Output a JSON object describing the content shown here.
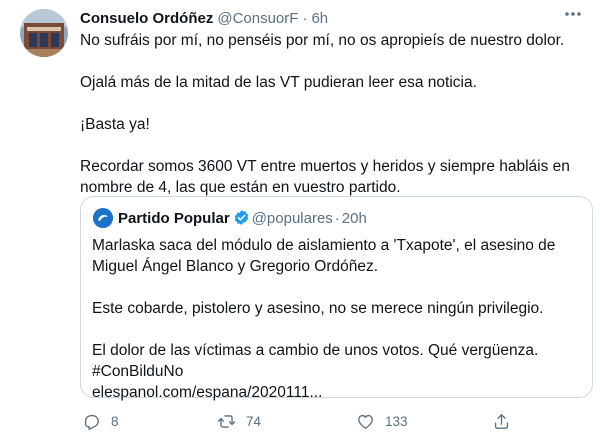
{
  "tweet": {
    "author_name": "Consuelo Ordóñez",
    "author_handle": "@ConsuorF",
    "separator": "·",
    "time": "6h",
    "lines": [
      "No sufráis por mí, no penséis por mí,  no os apropieís de nuestro dolor.",
      "",
      "Ojalá más de la mitad de las VT pudieran leer esa noticia.",
      "",
      "¡Basta ya!",
      "",
      "Recordar somos 3600 VT entre muertos y heridos y siempre habláis en",
      "nombre de 4, las que están en vuestro partido."
    ]
  },
  "quoted": {
    "author_name": "Partido Popular",
    "author_handle": "@populares",
    "separator": "·",
    "time": "20h",
    "lines": [
      "Marlaska saca del módulo de aislamiento a 'Txapote', el asesino de",
      "Miguel Ángel Blanco y Gregorio Ordóñez.",
      "",
      "Este cobarde, pistolero y asesino, no se merece ningún privilegio.",
      "",
      "El dolor de las víctimas a cambio de unos votos. Qué vergüenza.",
      "#ConBilduNo",
      "elespanol.com/espana/2020111..."
    ]
  },
  "actions": {
    "reply_icon": "reply-icon",
    "reply_count": "8",
    "retweet_icon": "retweet-icon",
    "retweet_count": "74",
    "like_icon": "heart-icon",
    "like_count": "133",
    "share_icon": "share-icon"
  },
  "colors": {
    "text": "#0f1419",
    "muted": "#5b7083",
    "border": "#cfd9de",
    "verified": "#1d9bf0",
    "pp_blue": "#1a73c9"
  }
}
